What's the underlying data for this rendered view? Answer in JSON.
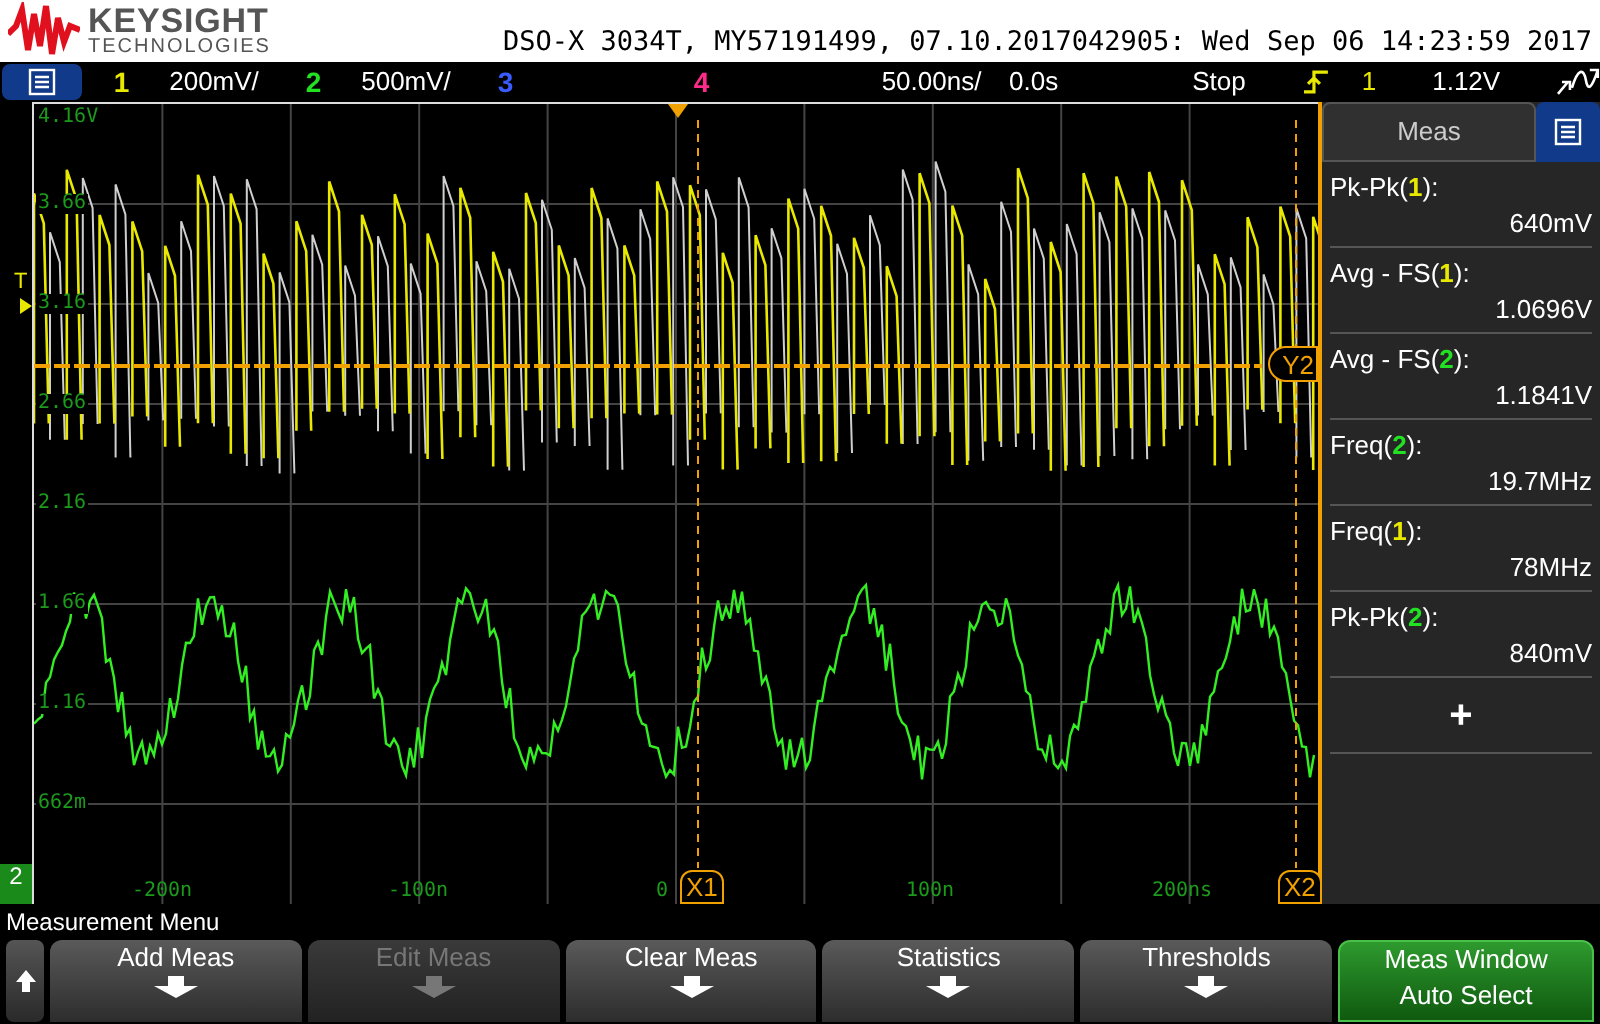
{
  "header": {
    "brand": "KEYSIGHT",
    "brand_sub": "TECHNOLOGIES",
    "title": "DSO-X 3034T, MY57191499, 07.10.2017042905: Wed Sep 06 14:23:59 2017"
  },
  "status_bar": {
    "channels": [
      {
        "number": "1",
        "scale": "200mV/",
        "color": "#e8e800"
      },
      {
        "number": "2",
        "scale": "500mV/",
        "color": "#22e022"
      },
      {
        "number": "3",
        "color": "#3a5cff"
      },
      {
        "number": "4",
        "color": "#ff2a8a"
      }
    ],
    "timebase": "50.00ns/",
    "delay": "0.0s",
    "run_state": "Stop",
    "trigger_source": "1",
    "trigger_level": "1.12V"
  },
  "plot": {
    "y_labels": [
      "4.16V",
      "3.66",
      "3.16",
      "2.66",
      "2.16",
      "1.66",
      "1.16",
      "662m"
    ],
    "x_labels": [
      "-200n",
      "-100n",
      "0",
      "100n",
      "200ns"
    ],
    "x_cursors": [
      {
        "label": "X1"
      },
      {
        "label": "X2"
      }
    ],
    "y_cursor": {
      "label": "Y2"
    },
    "trigger_marker": "T",
    "channel_badge": "2"
  },
  "meas_panel": {
    "title": "Meas",
    "items": [
      {
        "name": "Pk-Pk(",
        "channel": "1",
        "close": "):",
        "color": "#e8e800",
        "value": "640mV"
      },
      {
        "name": "Avg - FS(",
        "channel": "1",
        "close": "):",
        "color": "#e8e800",
        "value": "1.0696V"
      },
      {
        "name": "Avg - FS(",
        "channel": "2",
        "close": "):",
        "color": "#22e022",
        "value": "1.1841V"
      },
      {
        "name": "Freq(",
        "channel": "2",
        "close": "):",
        "color": "#22e022",
        "value": "19.7MHz"
      },
      {
        "name": "Freq(",
        "channel": "1",
        "close": "):",
        "color": "#e8e800",
        "value": "78MHz"
      },
      {
        "name": "Pk-Pk(",
        "channel": "2",
        "close": "):",
        "color": "#22e022",
        "value": "840mV"
      }
    ],
    "add": "+"
  },
  "softkey_menu": {
    "title": "Measurement Menu",
    "keys": [
      {
        "kind": "menu",
        "label": "Add Meas",
        "disabled": false
      },
      {
        "kind": "menu",
        "label": "Edit Meas",
        "disabled": true
      },
      {
        "kind": "menu",
        "label": "Clear Meas",
        "disabled": false
      },
      {
        "kind": "menu",
        "label": "Statistics",
        "disabled": false
      },
      {
        "kind": "menu",
        "label": "Thresholds",
        "disabled": false
      },
      {
        "kind": "toggle",
        "label": "Meas Window",
        "sub": "Auto Select",
        "disabled": false
      }
    ]
  }
}
